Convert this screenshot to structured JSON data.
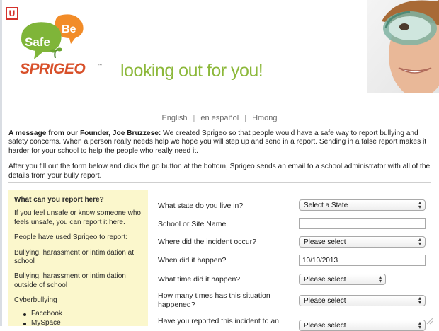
{
  "header": {
    "corner_badge": "U",
    "logo": {
      "word_be": "Be",
      "word_safe": "Safe",
      "word_brand": "SPRIGEO",
      "tm": "™"
    },
    "tagline": "looking out for you!"
  },
  "languages": {
    "english": "English",
    "spanish": "en español",
    "hmong": "Hmong",
    "separator": "|"
  },
  "message": {
    "lead": "A message from our Founder, Joe Bruzzese:",
    "body": " We created Sprigeo so that people would have a safe way to report bullying and safety concerns. When a person really needs help we hope you will step up and send in a report. Sending in a false report makes it harder for your school to help the people who really need it.",
    "second": "After you fill out the form below and click the go button at the bottom, Sprigeo sends an email to a school administrator with all of the details from your bully report."
  },
  "sidebar": {
    "title": "What can you report here?",
    "p1": "If you feel unsafe or know someone who feels unsafe, you can report it here.",
    "p2": "People have used Sprigeo to report:",
    "p3": "Bullying, harassment or intimidation at school",
    "p4": "Bullying, harassment or intimidation outside of school",
    "p5": "Cyberbullying",
    "list": [
      "Facebook",
      "MySpace"
    ]
  },
  "form": {
    "state_label": "What state do you live in?",
    "state_value": "Select a State",
    "school_label": "School or Site Name",
    "school_value": "",
    "where_label": "Where did the incident occur?",
    "where_value": "Please select",
    "when_label": "When did it happen?",
    "when_value": "10/10/2013",
    "time_label": "What time did it happen?",
    "time_value": "Please select",
    "times_label": "How many times has this situation happened?",
    "times_value": "Please select",
    "reported_label": "Have you reported this incident to an",
    "reported_value": "Please select"
  }
}
